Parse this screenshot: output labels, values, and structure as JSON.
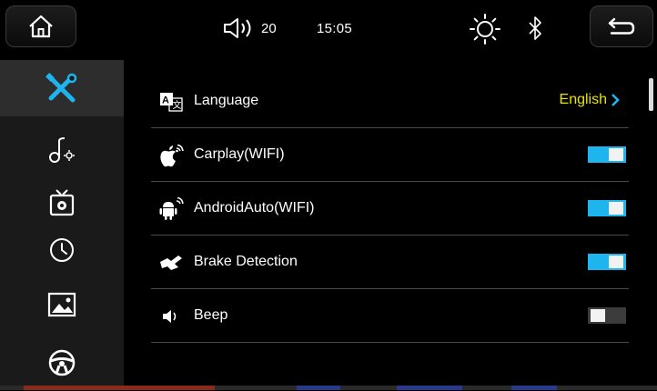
{
  "topbar": {
    "volume": "20",
    "time": "15:05",
    "icons": [
      "home-icon",
      "speaker-icon",
      "brightness-icon",
      "bluetooth-icon",
      "back-arrow-icon"
    ]
  },
  "sidebar": {
    "items": [
      {
        "icon": "settings-tools-icon",
        "active": true
      },
      {
        "icon": "music-settings-icon",
        "active": false
      },
      {
        "icon": "tv-settings-icon",
        "active": false
      },
      {
        "icon": "clock-icon",
        "active": false
      },
      {
        "icon": "picture-icon",
        "active": false
      },
      {
        "icon": "steering-wheel-icon",
        "active": false
      }
    ]
  },
  "settings": {
    "rows": [
      {
        "icon": "language-icon",
        "label": "Language",
        "value": "English"
      },
      {
        "icon": "apple-wifi-icon",
        "label": "Carplay(WIFI)",
        "toggle": true
      },
      {
        "icon": "android-wifi-icon",
        "label": "AndroidAuto(WIFI)",
        "toggle": true
      },
      {
        "icon": "brake-icon",
        "label": "Brake Detection",
        "toggle": true
      },
      {
        "icon": "beep-icon",
        "label": "Beep",
        "toggle": false
      }
    ]
  },
  "colors": {
    "accent_blue": "#1eb4ee",
    "value_yellow": "#e8e400",
    "sidebar_bg": "#1a1a1a",
    "sidebar_active": "#2d2d2d"
  }
}
